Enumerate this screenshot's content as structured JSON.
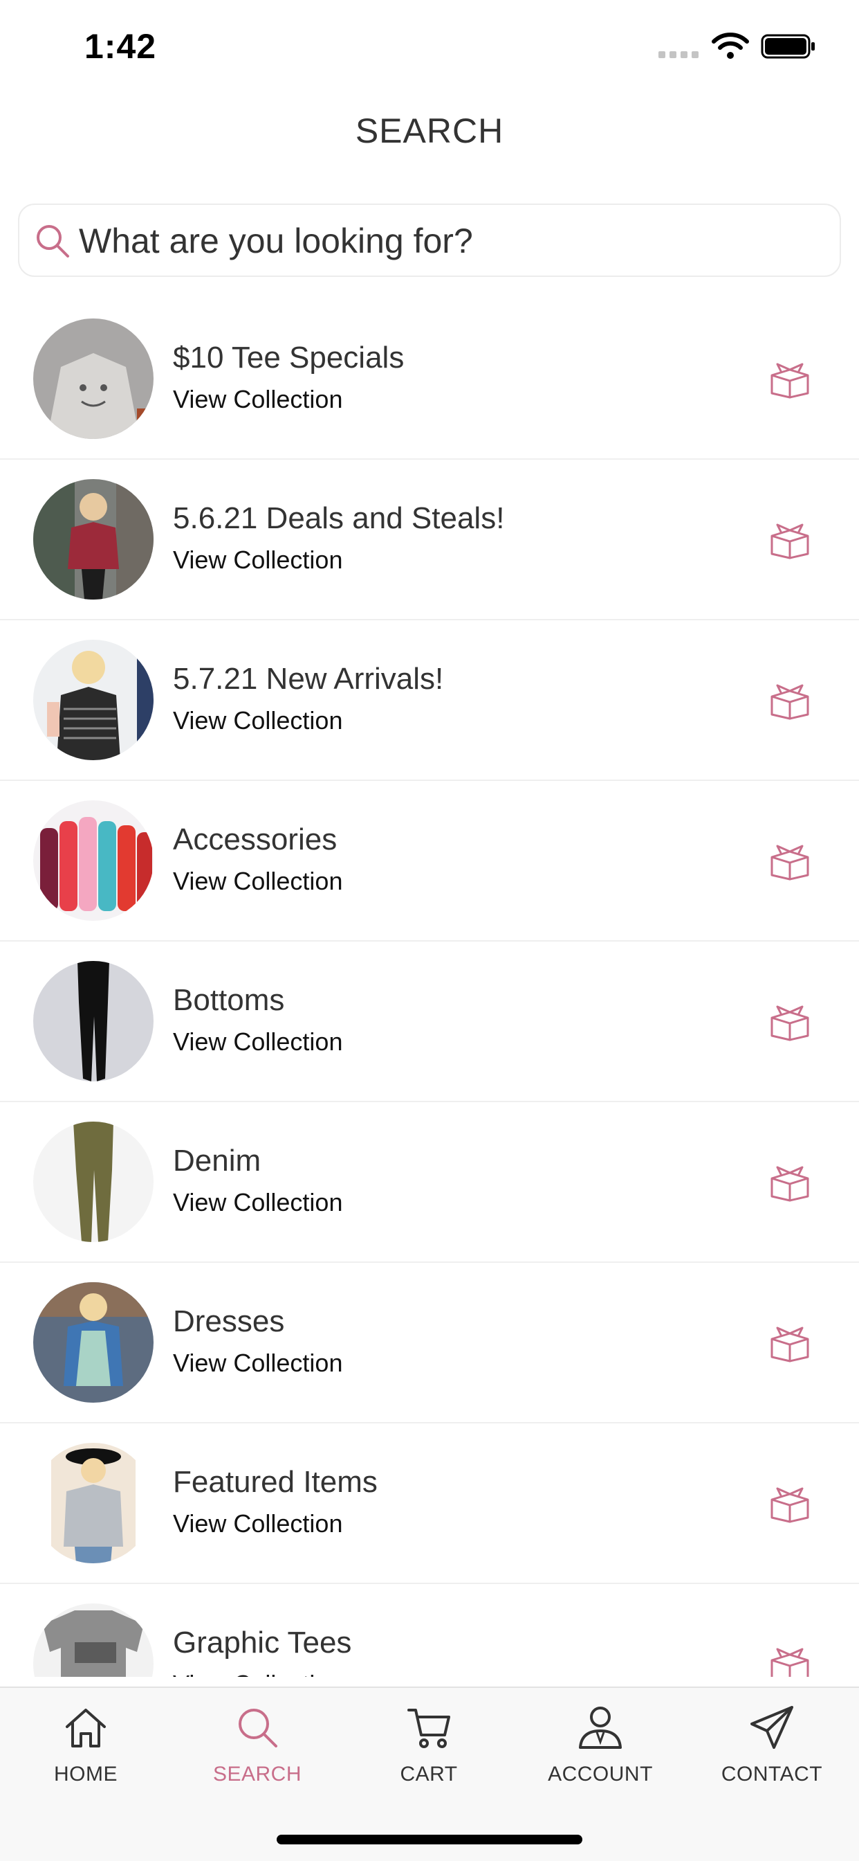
{
  "status_bar": {
    "time": "1:42"
  },
  "header": {
    "title": "SEARCH"
  },
  "search": {
    "placeholder": "What are you looking for?"
  },
  "colors": {
    "accent": "#c86e8a",
    "text": "#333333",
    "divider": "#efefef"
  },
  "collections": [
    {
      "title": "$10 Tee Specials",
      "subtitle": "View Collection",
      "icon": "gift-box-icon"
    },
    {
      "title": "5.6.21 Deals and Steals!",
      "subtitle": "View Collection",
      "icon": "gift-box-icon"
    },
    {
      "title": "5.7.21 New Arrivals!",
      "subtitle": "View Collection",
      "icon": "gift-box-icon"
    },
    {
      "title": "Accessories",
      "subtitle": "View Collection",
      "icon": "gift-box-icon"
    },
    {
      "title": "Bottoms",
      "subtitle": "View Collection",
      "icon": "gift-box-icon"
    },
    {
      "title": "Denim",
      "subtitle": "View Collection",
      "icon": "gift-box-icon"
    },
    {
      "title": "Dresses",
      "subtitle": "View Collection",
      "icon": "gift-box-icon"
    },
    {
      "title": "Featured Items",
      "subtitle": "View Collection",
      "icon": "gift-box-icon"
    },
    {
      "title": "Graphic Tees",
      "subtitle": "View Collection",
      "icon": "gift-box-icon"
    }
  ],
  "tab_bar": {
    "tabs": [
      {
        "label": "HOME",
        "icon": "home-icon"
      },
      {
        "label": "SEARCH",
        "icon": "search-icon"
      },
      {
        "label": "CART",
        "icon": "cart-icon"
      },
      {
        "label": "ACCOUNT",
        "icon": "account-icon"
      },
      {
        "label": "CONTACT",
        "icon": "paper-plane-icon"
      }
    ],
    "active": "SEARCH"
  }
}
